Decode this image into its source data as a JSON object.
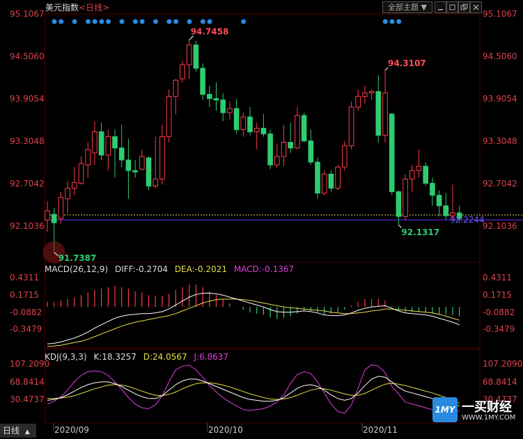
{
  "header": {
    "instrument": "美元指数",
    "timeframe": "<日线>",
    "theme_button": "全部主题",
    "theme_arrow": "▼"
  },
  "chart_data": [
    {
      "type": "candlestick",
      "panel": "price",
      "y_ticks": [
        "95.1067",
        "94.5060",
        "93.9054",
        "93.3048",
        "92.7042",
        "92.1036"
      ],
      "ylim": [
        91.6,
        95.12
      ],
      "annotations": {
        "high_label": "94.7458",
        "second_high_label": "94.3107",
        "low_label": "91.7387",
        "second_low_label": "92.1317",
        "last_price_label": "92.2244"
      },
      "reference_lines": {
        "dotted": 92.27,
        "solid": 92.2
      },
      "dot_markers_x": [
        0,
        1,
        3,
        5,
        6,
        7,
        8,
        10,
        12,
        13,
        15,
        17,
        18,
        20,
        22,
        23,
        28,
        49,
        50,
        51
      ],
      "candles": [
        {
          "o": 92.2,
          "h": 92.46,
          "l": 92.03,
          "c": 92.33
        },
        {
          "o": 92.28,
          "h": 92.37,
          "l": 91.74,
          "c": 92.16
        },
        {
          "o": 92.22,
          "h": 92.6,
          "l": 92.15,
          "c": 92.52
        },
        {
          "o": 92.5,
          "h": 92.75,
          "l": 92.3,
          "c": 92.65
        },
        {
          "o": 92.65,
          "h": 92.95,
          "l": 92.55,
          "c": 92.73
        },
        {
          "o": 92.72,
          "h": 93.1,
          "l": 92.7,
          "c": 93.0
        },
        {
          "o": 92.98,
          "h": 93.3,
          "l": 92.8,
          "c": 93.2
        },
        {
          "o": 93.15,
          "h": 93.6,
          "l": 92.98,
          "c": 93.45
        },
        {
          "o": 93.45,
          "h": 93.58,
          "l": 93.05,
          "c": 93.12
        },
        {
          "o": 93.12,
          "h": 93.48,
          "l": 92.9,
          "c": 93.38
        },
        {
          "o": 93.38,
          "h": 93.48,
          "l": 92.8,
          "c": 93.22
        },
        {
          "o": 93.22,
          "h": 93.55,
          "l": 92.95,
          "c": 93.05
        },
        {
          "o": 93.05,
          "h": 93.35,
          "l": 92.5,
          "c": 92.9
        },
        {
          "o": 92.9,
          "h": 93.05,
          "l": 92.8,
          "c": 92.88
        },
        {
          "o": 92.92,
          "h": 93.2,
          "l": 92.9,
          "c": 93.1
        },
        {
          "o": 93.08,
          "h": 93.1,
          "l": 92.62,
          "c": 92.68
        },
        {
          "o": 92.68,
          "h": 93.38,
          "l": 92.65,
          "c": 92.78
        },
        {
          "o": 92.78,
          "h": 93.55,
          "l": 92.7,
          "c": 93.38
        },
        {
          "o": 93.38,
          "h": 94.05,
          "l": 93.3,
          "c": 93.95
        },
        {
          "o": 93.95,
          "h": 94.2,
          "l": 93.7,
          "c": 94.18
        },
        {
          "o": 94.2,
          "h": 94.45,
          "l": 94.15,
          "c": 94.4
        },
        {
          "o": 94.4,
          "h": 94.75,
          "l": 94.2,
          "c": 94.68
        },
        {
          "o": 94.68,
          "h": 94.74,
          "l": 94.3,
          "c": 94.35
        },
        {
          "o": 94.35,
          "h": 94.42,
          "l": 93.9,
          "c": 93.98
        },
        {
          "o": 93.98,
          "h": 94.1,
          "l": 93.8,
          "c": 93.92
        },
        {
          "o": 93.92,
          "h": 94.15,
          "l": 93.75,
          "c": 93.9
        },
        {
          "o": 93.9,
          "h": 94.0,
          "l": 93.6,
          "c": 93.72
        },
        {
          "o": 93.72,
          "h": 93.88,
          "l": 93.62,
          "c": 93.78
        },
        {
          "o": 93.78,
          "h": 93.92,
          "l": 93.42,
          "c": 93.48
        },
        {
          "o": 93.48,
          "h": 93.72,
          "l": 93.38,
          "c": 93.66
        },
        {
          "o": 93.66,
          "h": 93.8,
          "l": 93.4,
          "c": 93.45
        },
        {
          "o": 93.45,
          "h": 93.58,
          "l": 93.2,
          "c": 93.5
        },
        {
          "o": 93.5,
          "h": 93.7,
          "l": 93.38,
          "c": 93.42
        },
        {
          "o": 93.42,
          "h": 93.48,
          "l": 92.92,
          "c": 92.98
        },
        {
          "o": 92.98,
          "h": 93.28,
          "l": 92.94,
          "c": 93.1
        },
        {
          "o": 93.1,
          "h": 93.55,
          "l": 92.96,
          "c": 93.3
        },
        {
          "o": 93.3,
          "h": 93.58,
          "l": 93.15,
          "c": 93.22
        },
        {
          "o": 93.22,
          "h": 93.8,
          "l": 93.2,
          "c": 93.68
        },
        {
          "o": 93.68,
          "h": 93.72,
          "l": 93.3,
          "c": 93.32
        },
        {
          "o": 93.32,
          "h": 93.48,
          "l": 92.98,
          "c": 93.02
        },
        {
          "o": 93.02,
          "h": 93.08,
          "l": 92.5,
          "c": 92.58
        },
        {
          "o": 92.58,
          "h": 92.9,
          "l": 92.55,
          "c": 92.85
        },
        {
          "o": 92.85,
          "h": 92.9,
          "l": 92.6,
          "c": 92.65
        },
        {
          "o": 92.65,
          "h": 92.98,
          "l": 92.62,
          "c": 92.95
        },
        {
          "o": 92.95,
          "h": 93.32,
          "l": 92.9,
          "c": 93.25
        },
        {
          "o": 93.25,
          "h": 93.88,
          "l": 93.2,
          "c": 93.8
        },
        {
          "o": 93.8,
          "h": 94.05,
          "l": 93.75,
          "c": 93.95
        },
        {
          "o": 93.95,
          "h": 94.1,
          "l": 93.85,
          "c": 94.0
        },
        {
          "o": 94.0,
          "h": 94.05,
          "l": 93.9,
          "c": 94.02
        },
        {
          "o": 94.02,
          "h": 94.25,
          "l": 93.3,
          "c": 93.4
        },
        {
          "o": 93.4,
          "h": 94.32,
          "l": 93.3,
          "c": 94.0
        },
        {
          "o": 93.7,
          "h": 93.72,
          "l": 92.55,
          "c": 92.6
        },
        {
          "o": 92.6,
          "h": 92.62,
          "l": 92.13,
          "c": 92.25
        },
        {
          "o": 92.25,
          "h": 92.85,
          "l": 92.2,
          "c": 92.78
        },
        {
          "o": 92.78,
          "h": 92.98,
          "l": 92.6,
          "c": 92.9
        },
        {
          "o": 92.9,
          "h": 93.2,
          "l": 92.8,
          "c": 92.96
        },
        {
          "o": 92.96,
          "h": 93.02,
          "l": 92.68,
          "c": 92.72
        },
        {
          "o": 92.72,
          "h": 92.8,
          "l": 92.4,
          "c": 92.55
        },
        {
          "o": 92.55,
          "h": 92.62,
          "l": 92.25,
          "c": 92.4
        },
        {
          "o": 92.4,
          "h": 92.58,
          "l": 92.2,
          "c": 92.26
        },
        {
          "o": 92.26,
          "h": 92.7,
          "l": 92.2,
          "c": 92.3
        },
        {
          "o": 92.3,
          "h": 92.4,
          "l": 92.18,
          "c": 92.22
        }
      ]
    },
    {
      "type": "line+bar",
      "panel": "macd",
      "header": [
        "MACD(26,12,9)",
        "DIFF:-0.2704",
        "DEA:-0.2021",
        "MACD:-0.1367"
      ],
      "y_ticks": [
        "0.4311",
        "0.1715",
        "-0.0882",
        "-0.3479"
      ],
      "ylim": [
        -0.62,
        0.52
      ],
      "diff": [
        -0.56,
        -0.55,
        -0.53,
        -0.5,
        -0.47,
        -0.43,
        -0.38,
        -0.32,
        -0.27,
        -0.22,
        -0.17,
        -0.14,
        -0.12,
        -0.11,
        -0.1,
        -0.1,
        -0.09,
        -0.07,
        -0.03,
        0.03,
        0.09,
        0.15,
        0.19,
        0.21,
        0.21,
        0.2,
        0.18,
        0.15,
        0.12,
        0.09,
        0.06,
        0.03,
        0.0,
        -0.04,
        -0.07,
        -0.08,
        -0.08,
        -0.07,
        -0.06,
        -0.07,
        -0.09,
        -0.12,
        -0.13,
        -0.13,
        -0.12,
        -0.09,
        -0.05,
        -0.02,
        0.0,
        0.01,
        0.02,
        -0.02,
        -0.06,
        -0.09,
        -0.1,
        -0.11,
        -0.12,
        -0.14,
        -0.17,
        -0.2,
        -0.23,
        -0.27
      ],
      "dea": [
        -0.6,
        -0.59,
        -0.58,
        -0.56,
        -0.54,
        -0.52,
        -0.49,
        -0.45,
        -0.41,
        -0.37,
        -0.33,
        -0.29,
        -0.26,
        -0.23,
        -0.21,
        -0.19,
        -0.17,
        -0.15,
        -0.13,
        -0.1,
        -0.06,
        -0.02,
        0.02,
        0.06,
        0.09,
        0.11,
        0.12,
        0.12,
        0.12,
        0.11,
        0.1,
        0.08,
        0.06,
        0.04,
        0.02,
        0.0,
        -0.01,
        -0.02,
        -0.03,
        -0.04,
        -0.05,
        -0.06,
        -0.08,
        -0.09,
        -0.1,
        -0.1,
        -0.09,
        -0.08,
        -0.06,
        -0.05,
        -0.03,
        -0.03,
        -0.04,
        -0.05,
        -0.06,
        -0.07,
        -0.08,
        -0.09,
        -0.11,
        -0.14,
        -0.17,
        -0.2
      ],
      "hist": [
        0.08,
        0.08,
        0.1,
        0.12,
        0.14,
        0.18,
        0.22,
        0.26,
        0.28,
        0.3,
        0.32,
        0.3,
        0.28,
        0.24,
        0.22,
        0.18,
        0.16,
        0.16,
        0.2,
        0.26,
        0.3,
        0.34,
        0.34,
        0.3,
        0.24,
        0.18,
        0.12,
        0.06,
        0.0,
        -0.04,
        -0.08,
        -0.1,
        -0.12,
        -0.16,
        -0.18,
        -0.16,
        -0.14,
        -0.1,
        -0.06,
        -0.06,
        -0.08,
        -0.12,
        -0.1,
        -0.08,
        -0.04,
        0.02,
        0.08,
        0.12,
        0.12,
        0.12,
        0.1,
        0.02,
        -0.04,
        -0.08,
        -0.08,
        -0.08,
        -0.08,
        -0.1,
        -0.12,
        -0.12,
        -0.12,
        -0.14
      ]
    },
    {
      "type": "line",
      "panel": "kdj",
      "header": [
        "KDJ(9,3,3)",
        "K:18.3257",
        "D:24.0567",
        "J:6.8637"
      ],
      "y_ticks": [
        "107.2090",
        "68.8414",
        "30.4737"
      ],
      "ylim": [
        -10,
        112
      ],
      "k": [
        30,
        32,
        36,
        42,
        50,
        58,
        64,
        68,
        70,
        70,
        66,
        60,
        52,
        44,
        38,
        34,
        34,
        40,
        52,
        64,
        72,
        76,
        76,
        72,
        66,
        60,
        54,
        48,
        42,
        36,
        32,
        30,
        28,
        28,
        30,
        36,
        46,
        56,
        62,
        64,
        60,
        52,
        42,
        34,
        30,
        34,
        46,
        62,
        76,
        82,
        80,
        70,
        58,
        50,
        46,
        42,
        38,
        34,
        30,
        26,
        22,
        18
      ],
      "d": [
        34,
        34,
        35,
        37,
        40,
        45,
        50,
        55,
        59,
        63,
        64,
        63,
        60,
        55,
        50,
        45,
        41,
        40,
        43,
        48,
        55,
        61,
        66,
        68,
        68,
        66,
        63,
        59,
        54,
        49,
        44,
        40,
        36,
        33,
        32,
        33,
        36,
        41,
        47,
        52,
        55,
        55,
        52,
        48,
        44,
        41,
        41,
        45,
        52,
        59,
        65,
        67,
        65,
        62,
        58,
        54,
        50,
        46,
        41,
        36,
        30,
        24
      ],
      "j": [
        22,
        28,
        38,
        52,
        70,
        84,
        92,
        94,
        92,
        84,
        70,
        54,
        36,
        22,
        14,
        12,
        20,
        40,
        70,
        96,
        104,
        106,
        96,
        80,
        62,
        48,
        36,
        26,
        18,
        10,
        8,
        10,
        12,
        18,
        26,
        42,
        66,
        86,
        92,
        88,
        70,
        46,
        22,
        6,
        2,
        20,
        56,
        96,
        107,
        104,
        90,
        60,
        44,
        26,
        22,
        18,
        14,
        10,
        6,
        4,
        6,
        7
      ]
    }
  ],
  "x_axis": {
    "labels": [
      "2020/09",
      "2020/10",
      "2020/11"
    ]
  },
  "footer": {
    "timeframe_button": "日线",
    "arrow": "▲"
  },
  "watermark": {
    "badge": "1MY",
    "name": "一买财经",
    "url": "WWW.1MY.COM"
  },
  "colors": {
    "up": "#ff3b4b",
    "down": "#2ecc71",
    "diff": "#ffffff",
    "dea": "#e8e04a",
    "j": "#e040e0",
    "axis": "#e0404a",
    "grid": "#4a0000",
    "marker": "#2a8ae0"
  }
}
